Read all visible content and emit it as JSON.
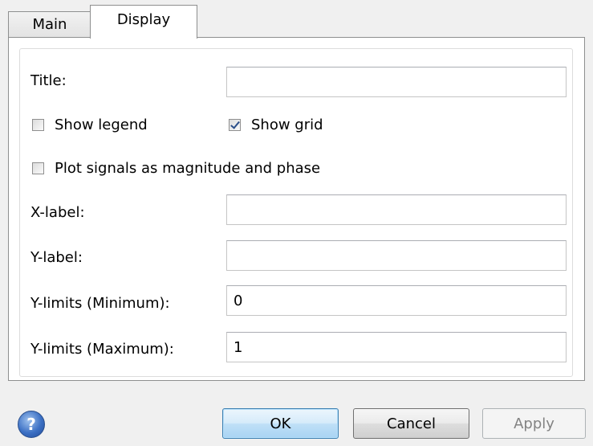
{
  "tabs": [
    {
      "label": "Main"
    },
    {
      "label": "Display"
    }
  ],
  "fields": {
    "title": {
      "label": "Title:",
      "value": ""
    },
    "xlabel": {
      "label": "X-label:",
      "value": ""
    },
    "ylabel": {
      "label": "Y-label:",
      "value": ""
    },
    "ymin": {
      "label": "Y-limits (Minimum):",
      "value": "0"
    },
    "ymax": {
      "label": "Y-limits (Maximum):",
      "value": "1"
    }
  },
  "checkboxes": {
    "show_legend": {
      "label": "Show legend",
      "checked": false
    },
    "show_grid": {
      "label": "Show grid",
      "checked": true
    },
    "magnitude_phase": {
      "label": "Plot signals as magnitude and phase",
      "checked": false
    }
  },
  "buttons": {
    "help": "?",
    "ok": "OK",
    "cancel": "Cancel",
    "apply": "Apply"
  }
}
